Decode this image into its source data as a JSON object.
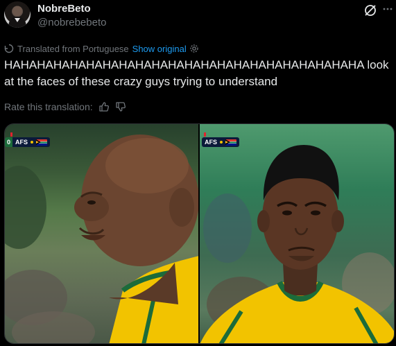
{
  "tweet": {
    "author_name": "NobreBeto",
    "author_handle": "@nobrebebeto",
    "translated_from": "Translated from Portuguese",
    "show_original": "Show original",
    "text": "HAHAHAHAHAHAHAHAHAHAHAHAHAHAHAHAHAHAHAHAHAHA look at the faces of these crazy guys trying to understand",
    "rate_translation": "Rate this translation:"
  },
  "media": {
    "left_badge": {
      "score": "0",
      "team": "AFS"
    },
    "right_badge": {
      "team": "AFS"
    }
  },
  "icons": {
    "grok": "grok-icon",
    "more": "more-icon",
    "translate": "translate-icon",
    "settings": "gear-icon",
    "thumbs_up": "thumbs-up-icon",
    "thumbs_down": "thumbs-down-icon"
  },
  "colors": {
    "background": "#000000",
    "text": "#e7e9ea",
    "muted": "#71767b",
    "link": "#1d9bf0",
    "jersey": "#f2c300",
    "jersey_trim": "#1c6b3a"
  }
}
